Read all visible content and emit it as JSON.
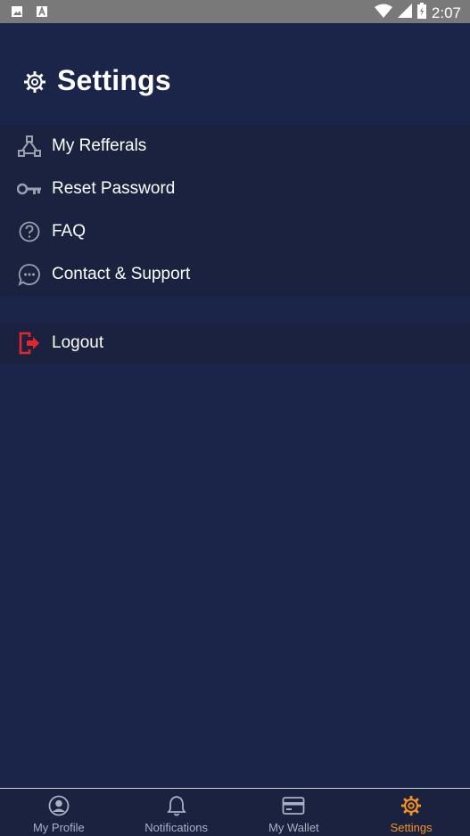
{
  "status_bar": {
    "time": "2:07",
    "icons": [
      "image-icon",
      "a-notification-icon",
      "wifi-icon",
      "signal-icon",
      "battery-icon"
    ]
  },
  "header": {
    "title": "Settings",
    "icon": "gear-icon"
  },
  "menu": {
    "items": [
      {
        "label": "My Refferals",
        "icon": "network-icon"
      },
      {
        "label": "Reset Password",
        "icon": "key-icon"
      },
      {
        "label": "FAQ",
        "icon": "question-circle-icon"
      },
      {
        "label": "Contact & Support",
        "icon": "chat-bubble-icon"
      }
    ],
    "logout": {
      "label": "Logout",
      "icon": "logout-icon",
      "color": "#e3262b"
    }
  },
  "bottom_nav": {
    "tabs": [
      {
        "label": "My Profile",
        "icon": "user-icon"
      },
      {
        "label": "Notifications",
        "icon": "bell-icon"
      },
      {
        "label": "My Wallet",
        "icon": "wallet-icon"
      },
      {
        "label": "Settings",
        "icon": "gear-icon",
        "active": true
      }
    ],
    "active_color": "#f7931e",
    "inactive_color": "#a9b0c4"
  },
  "colors": {
    "background": "#1b2449",
    "menu_background": "#1a2240",
    "status_bar": "#797979"
  }
}
